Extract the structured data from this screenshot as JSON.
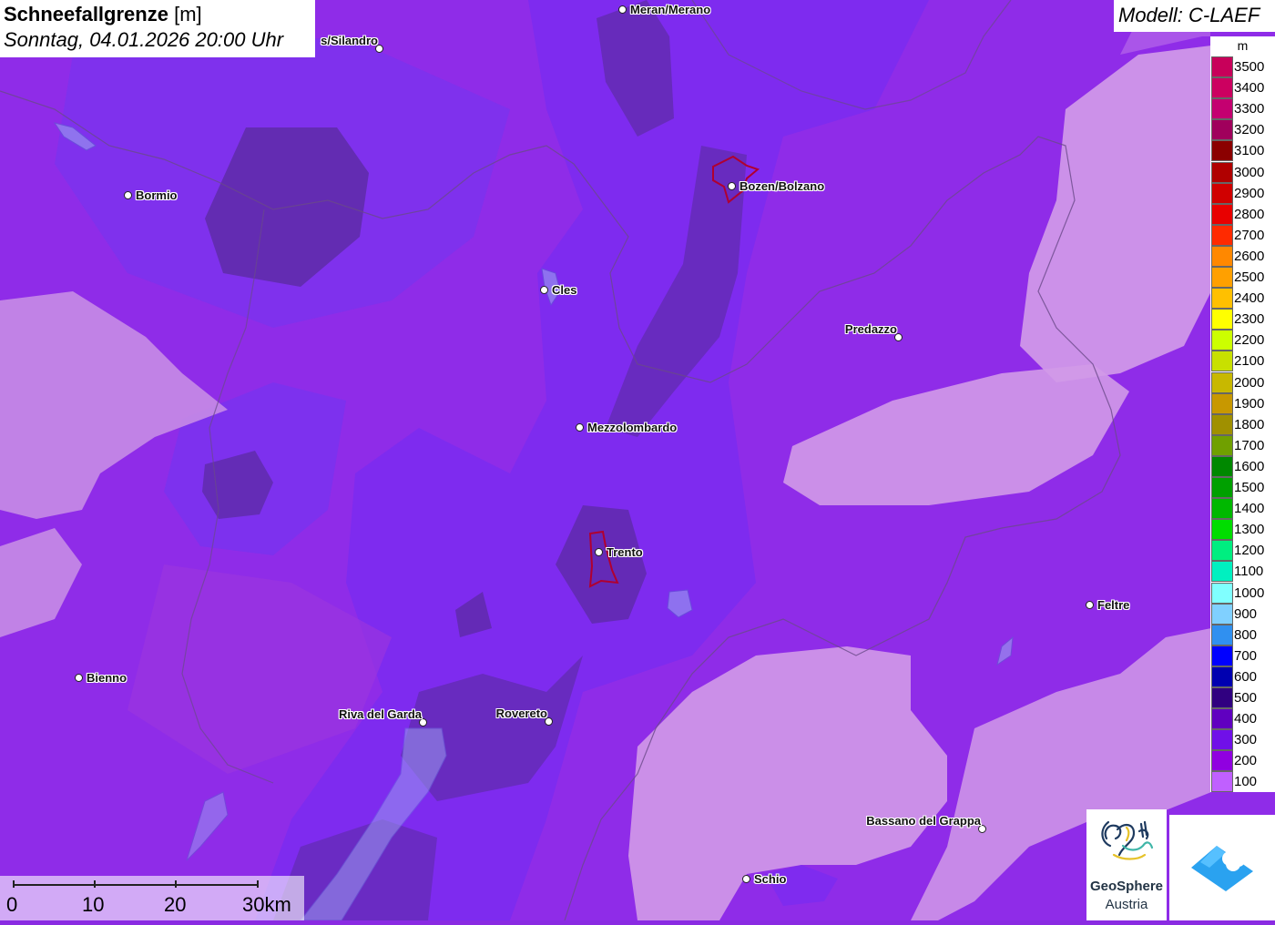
{
  "header": {
    "title_main": "Schneefallgrenze",
    "title_unit": "[m]",
    "subtitle": "Sonntag, 04.01.2026 20:00 Uhr"
  },
  "model": {
    "label": "Modell: C-LAEF"
  },
  "legend": {
    "unit": "m",
    "items": [
      {
        "label": "3500",
        "color": "#c8005a"
      },
      {
        "label": "3400",
        "color": "#cc0060"
      },
      {
        "label": "3300",
        "color": "#c40070"
      },
      {
        "label": "3200",
        "color": "#a0005c"
      },
      {
        "label": "3100",
        "color": "#8b0000"
      },
      {
        "label": "3000",
        "color": "#b00000"
      },
      {
        "label": "2900",
        "color": "#d00000"
      },
      {
        "label": "2800",
        "color": "#e80000"
      },
      {
        "label": "2700",
        "color": "#ff2a00"
      },
      {
        "label": "2600",
        "color": "#ff8800"
      },
      {
        "label": "2500",
        "color": "#ffa000"
      },
      {
        "label": "2400",
        "color": "#ffc000"
      },
      {
        "label": "2300",
        "color": "#ffff00"
      },
      {
        "label": "2200",
        "color": "#ccff00"
      },
      {
        "label": "2100",
        "color": "#c8e000"
      },
      {
        "label": "2000",
        "color": "#c8b800"
      },
      {
        "label": "1900",
        "color": "#c89800"
      },
      {
        "label": "1800",
        "color": "#a09000"
      },
      {
        "label": "1700",
        "color": "#70a000"
      },
      {
        "label": "1600",
        "color": "#008800"
      },
      {
        "label": "1500",
        "color": "#00a000"
      },
      {
        "label": "1400",
        "color": "#00b800"
      },
      {
        "label": "1300",
        "color": "#00dd00"
      },
      {
        "label": "1200",
        "color": "#00ee80"
      },
      {
        "label": "1100",
        "color": "#00f0c0"
      },
      {
        "label": "1000",
        "color": "#80ffff"
      },
      {
        "label": "900",
        "color": "#80d0ff"
      },
      {
        "label": "800",
        "color": "#3090f0"
      },
      {
        "label": "700",
        "color": "#0000ff"
      },
      {
        "label": "600",
        "color": "#0000b0"
      },
      {
        "label": "500",
        "color": "#300080"
      },
      {
        "label": "400",
        "color": "#6000c0"
      },
      {
        "label": "300",
        "color": "#7010e8"
      },
      {
        "label": "200",
        "color": "#9000e0"
      },
      {
        "label": "100",
        "color": "#c060ff"
      }
    ]
  },
  "cities": [
    {
      "name": "Meran/Merano"
    },
    {
      "name": "s/Silandro"
    },
    {
      "name": "Bormio"
    },
    {
      "name": "Bozen/Bolzano"
    },
    {
      "name": "Cles"
    },
    {
      "name": "Predazzo"
    },
    {
      "name": "Mezzolombardo"
    },
    {
      "name": "Trento"
    },
    {
      "name": "Feltre"
    },
    {
      "name": "Bienno"
    },
    {
      "name": "Riva del Garda"
    },
    {
      "name": "Rovereto"
    },
    {
      "name": "Bassano del Grappa"
    },
    {
      "name": "Schio"
    }
  ],
  "scale": {
    "labels": [
      "0",
      "10",
      "20",
      "30km"
    ]
  },
  "logos": {
    "geosphere_line1": "GeoSphere",
    "geosphere_line2": "Austria"
  }
}
